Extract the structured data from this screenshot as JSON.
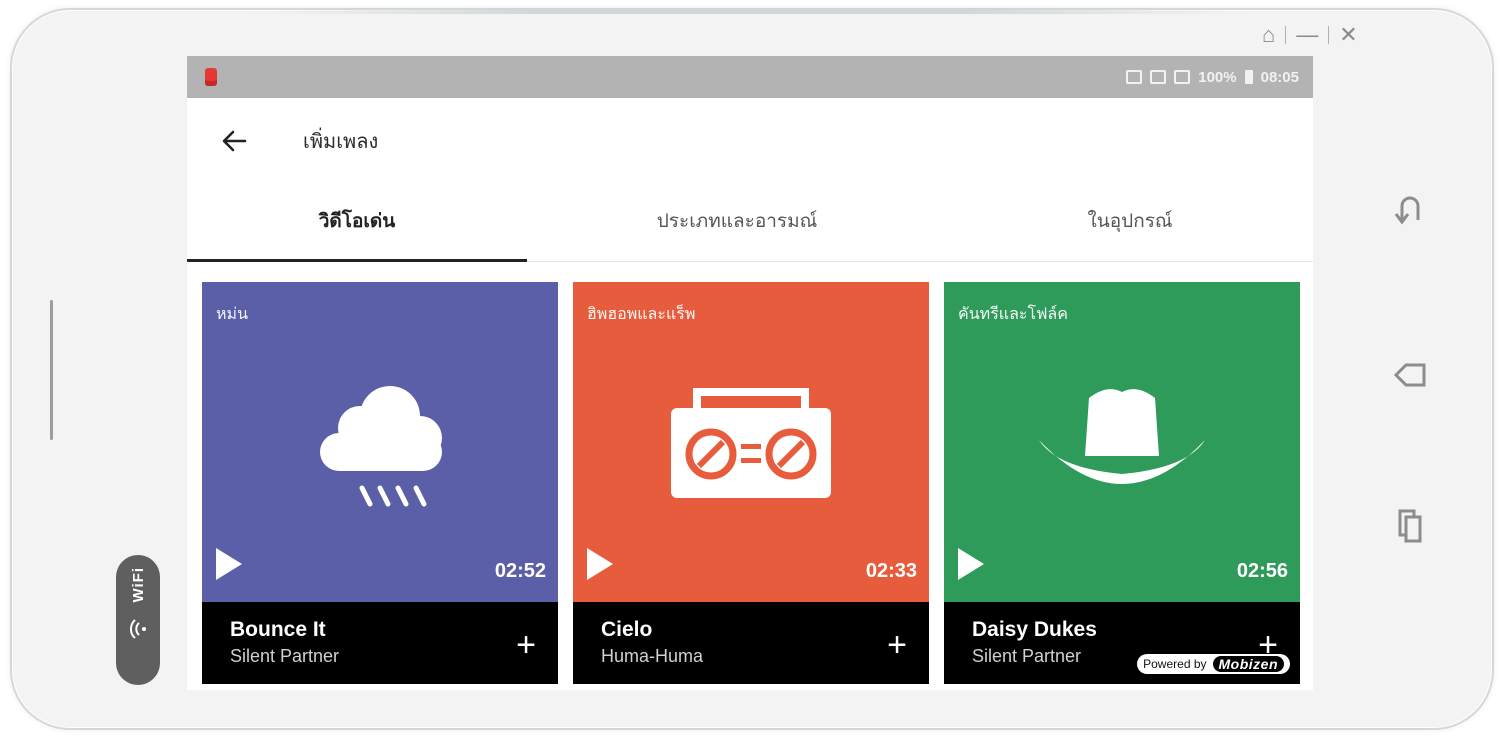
{
  "window": {
    "controls": [
      "⌂",
      "—",
      "✕"
    ]
  },
  "status_bar": {
    "right_text": "100%",
    "time": "08:05"
  },
  "toolbar": {
    "title": "เพิ่มเพลง"
  },
  "tabs": [
    {
      "label": "วิดีโอเด่น",
      "active": true
    },
    {
      "label": "ประเภทและอารมณ์",
      "active": false
    },
    {
      "label": "ในอุปกรณ์",
      "active": false
    }
  ],
  "cards": [
    {
      "tag": "หม่น",
      "duration": "02:52",
      "title": "Bounce It",
      "artist": "Silent Partner",
      "color": "#5b5fa8",
      "icon": "rain-cloud-icon"
    },
    {
      "tag": "ฮิพฮอพและแร็พ",
      "duration": "02:33",
      "title": "Cielo",
      "artist": "Huma-Huma",
      "color": "#e85c3e",
      "icon": "boombox-icon"
    },
    {
      "tag": "คันทรีและโฟล์ค",
      "duration": "02:56",
      "title": "Daisy Dukes",
      "artist": "Silent Partner",
      "color": "#2e9b5a",
      "icon": "cowboy-hat-icon"
    }
  ],
  "wifi": {
    "label": "WiFi"
  },
  "watermark": {
    "prefix": "Powered by",
    "brand": "Mobizen"
  },
  "colors": {
    "status_bar": "#b3b3b3",
    "card_info_bg": "#000000"
  }
}
